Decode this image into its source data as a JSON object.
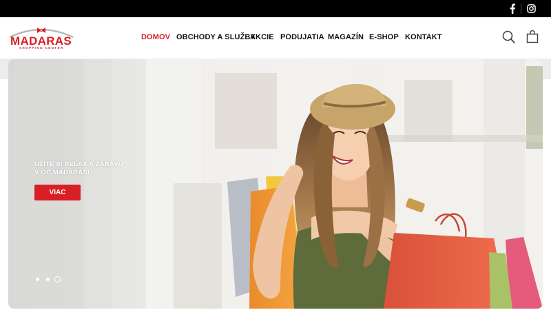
{
  "topbar": {
    "social": [
      {
        "name": "facebook-icon",
        "glyph": "f"
      },
      {
        "name": "instagram-icon"
      }
    ]
  },
  "header": {
    "logo": {
      "text": "MADARAS",
      "subtext": "SHOPPING CENTER"
    },
    "nav": [
      {
        "label": "DOMOV",
        "active": true
      },
      {
        "label": "OBCHODY A SLUŽBY",
        "active": false
      },
      {
        "label": "AKCIE",
        "active": false
      },
      {
        "label": "PODUJATIA",
        "active": false
      },
      {
        "label": "MAGAZÍN",
        "active": false
      },
      {
        "label": "E-SHOP",
        "active": false
      },
      {
        "label": "KONTAKT",
        "active": false
      }
    ],
    "icons": [
      "search-icon",
      "shopping-bag-icon"
    ]
  },
  "hero": {
    "caption_line1": "UŽITE SI RELAX A ZÁBAVU",
    "caption_line2": "V OC MADARAS!",
    "button_label": "VIAC",
    "slides_count": 3,
    "active_slide": 3
  },
  "colors": {
    "brand_red": "#d81f26",
    "topbar": "#000000",
    "nav_text": "#111111"
  }
}
